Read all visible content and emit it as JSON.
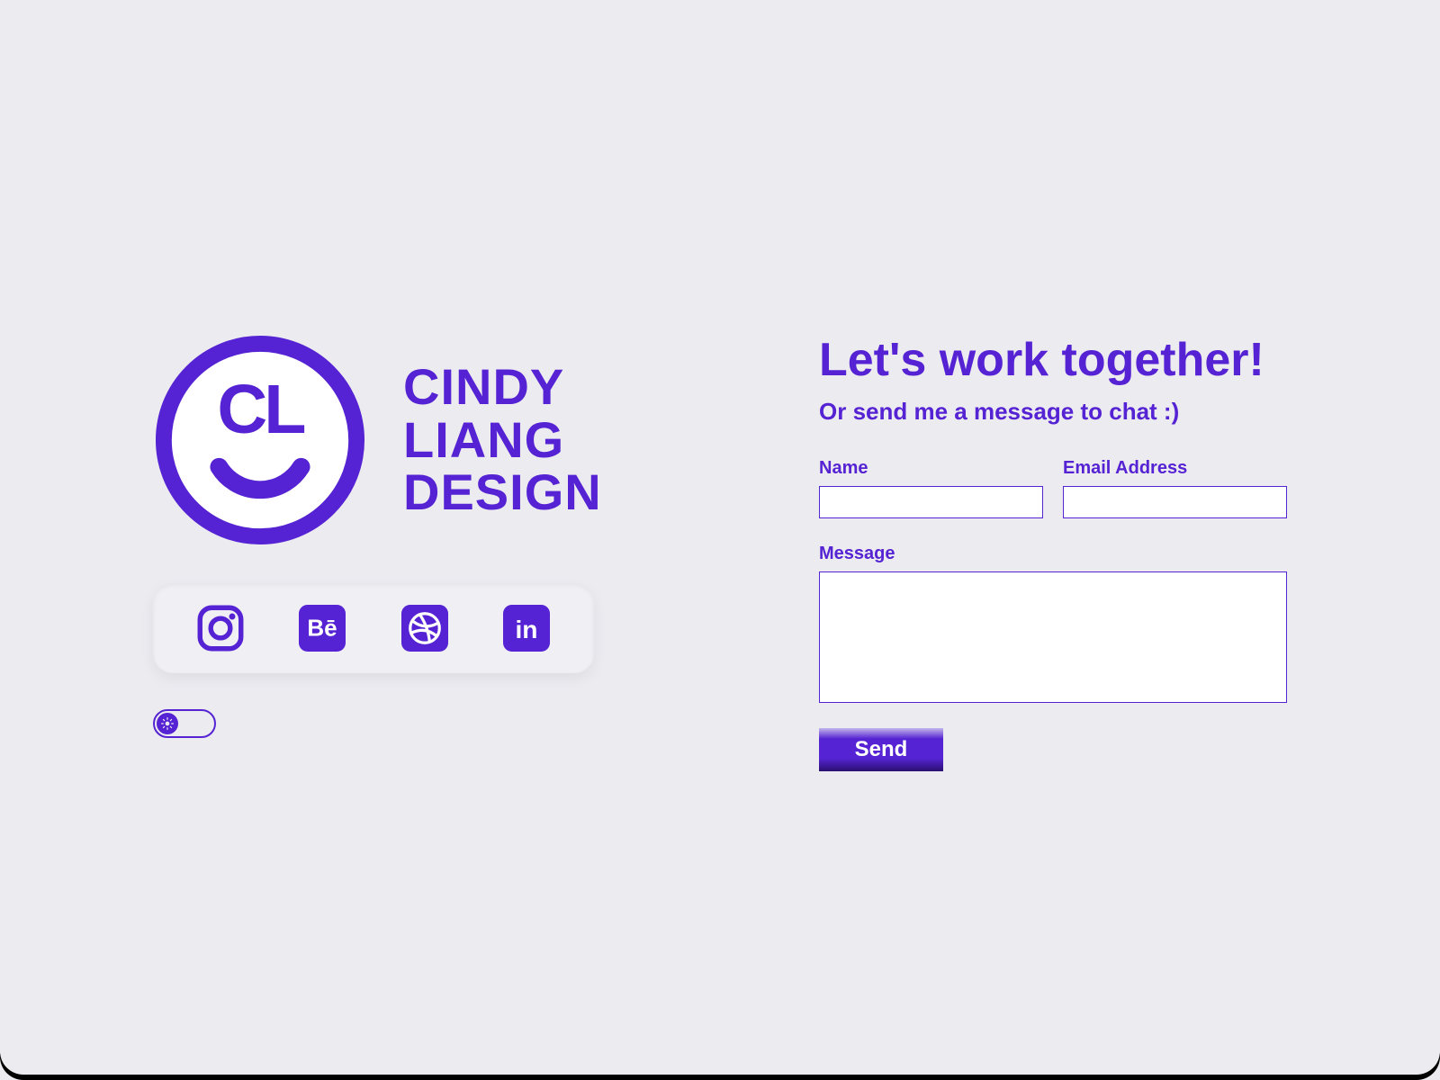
{
  "colors": {
    "accent": "#5523d3",
    "bg": "#ecebf0"
  },
  "brand": {
    "logo_letters": "CL",
    "line1": "CINDY",
    "line2": "LIANG",
    "line3": "DESIGN"
  },
  "social": {
    "instagram": "instagram",
    "behance": "behance",
    "dribbble": "dribbble",
    "linkedin": "linkedin"
  },
  "toggle": {
    "state": "off",
    "icon": "sun"
  },
  "contact": {
    "headline": "Let's work together!",
    "subhead": "Or send me a message to chat :)",
    "name_label": "Name",
    "email_label": "Email Address",
    "message_label": "Message",
    "name_value": "",
    "email_value": "",
    "message_value": "",
    "send_label": "Send"
  }
}
